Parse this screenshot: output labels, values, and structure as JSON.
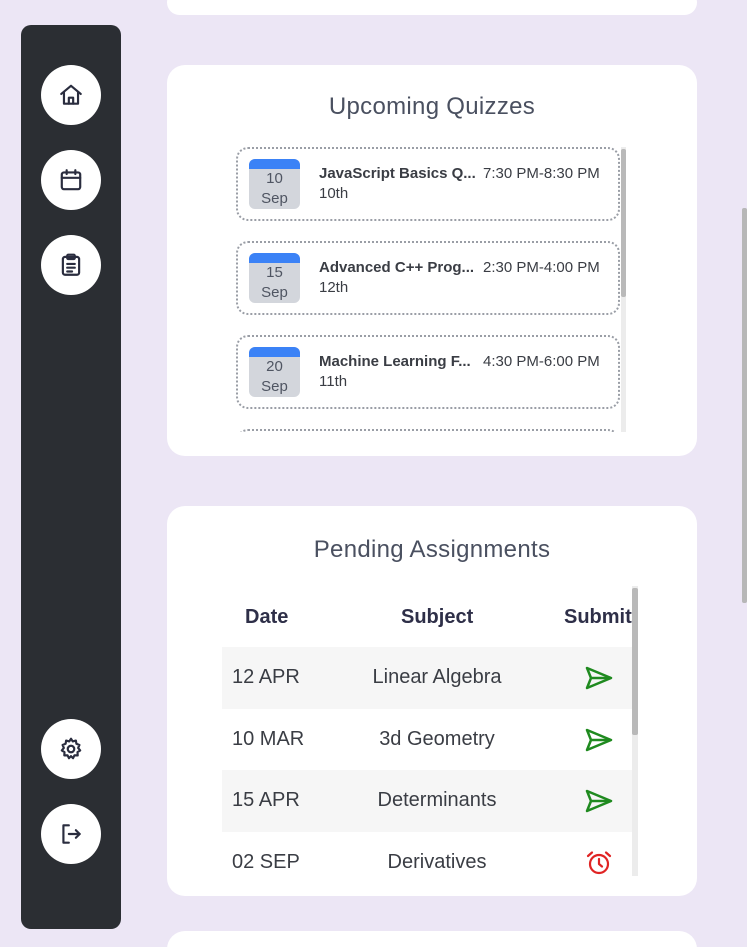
{
  "sidebar": {
    "items": [
      {
        "name": "home",
        "icon": "home-icon"
      },
      {
        "name": "calendar",
        "icon": "calendar-icon"
      },
      {
        "name": "quizzes",
        "icon": "clipboard-icon"
      }
    ],
    "bottom_items": [
      {
        "name": "settings",
        "icon": "gear-icon"
      },
      {
        "name": "logout",
        "icon": "logout-icon"
      }
    ]
  },
  "quizzes": {
    "title": "Upcoming Quizzes",
    "items": [
      {
        "day": "10",
        "month": "Sep",
        "name": "JavaScript Basics Q...",
        "time": "7:30 PM-8:30 PM",
        "sub": "10th"
      },
      {
        "day": "15",
        "month": "Sep",
        "name": "Advanced C++ Prog...",
        "time": "2:30 PM-4:00 PM",
        "sub": "12th"
      },
      {
        "day": "20",
        "month": "Sep",
        "name": "Machine Learning F...",
        "time": "4:30 PM-6:00 PM",
        "sub": "11th"
      }
    ]
  },
  "assignments": {
    "title": "Pending Assignments",
    "headers": {
      "date": "Date",
      "subject": "Subject",
      "submit": "Submit"
    },
    "rows": [
      {
        "date": "12 APR",
        "subject": "Linear Algebra",
        "status": "send"
      },
      {
        "date": "10 MAR",
        "subject": "3d Geometry",
        "status": "send"
      },
      {
        "date": "15 APR",
        "subject": "Determinants",
        "status": "send"
      },
      {
        "date": "02 SEP",
        "subject": "Derivatives",
        "status": "overdue"
      }
    ]
  },
  "colors": {
    "background": "#ece6f5",
    "sidebar": "#2b2e33",
    "calendar_accent": "#3b82f6",
    "send_icon": "#1f8a1f",
    "overdue_icon": "#e02424"
  }
}
